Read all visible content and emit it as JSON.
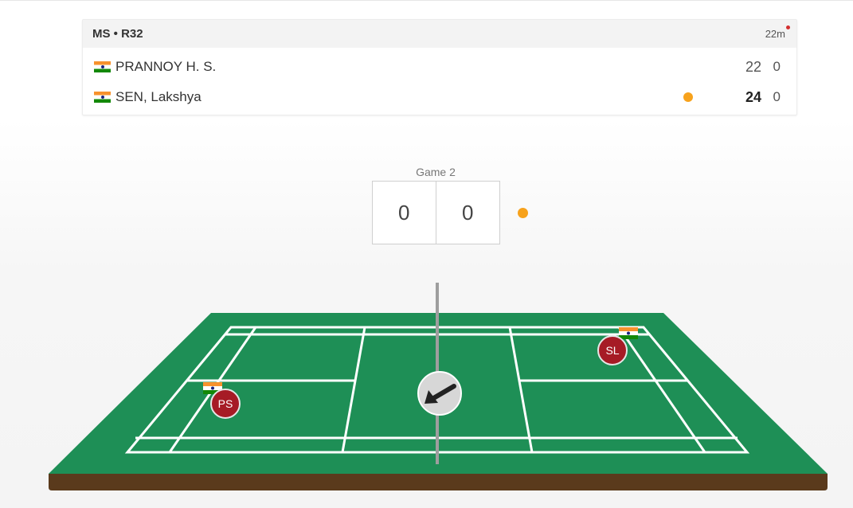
{
  "match": {
    "round": "MS • R32",
    "elapsed": "22m",
    "players": [
      {
        "name": "PRANNOY H. S.",
        "country": "India",
        "score_game1": "22",
        "score_game2": "0",
        "serving": false,
        "winner": false
      },
      {
        "name": "SEN, Lakshya",
        "country": "India",
        "score_game1": "24",
        "score_game2": "0",
        "serving": true,
        "winner": true
      }
    ]
  },
  "current_game": {
    "label": "Game 2",
    "left_score": "0",
    "right_score": "0"
  },
  "court": {
    "left_player": {
      "initials": "PS",
      "country": "India"
    },
    "right_player": {
      "initials": "SL",
      "country": "India"
    },
    "shuttle_direction_icon": "arrow-down-left-icon"
  },
  "colors": {
    "court_green": "#1e8f56",
    "court_base": "#5a3a1c",
    "player_badge": "#a61b25",
    "serve_dot": "#f7a21c",
    "live_dot": "#d32f2f"
  }
}
